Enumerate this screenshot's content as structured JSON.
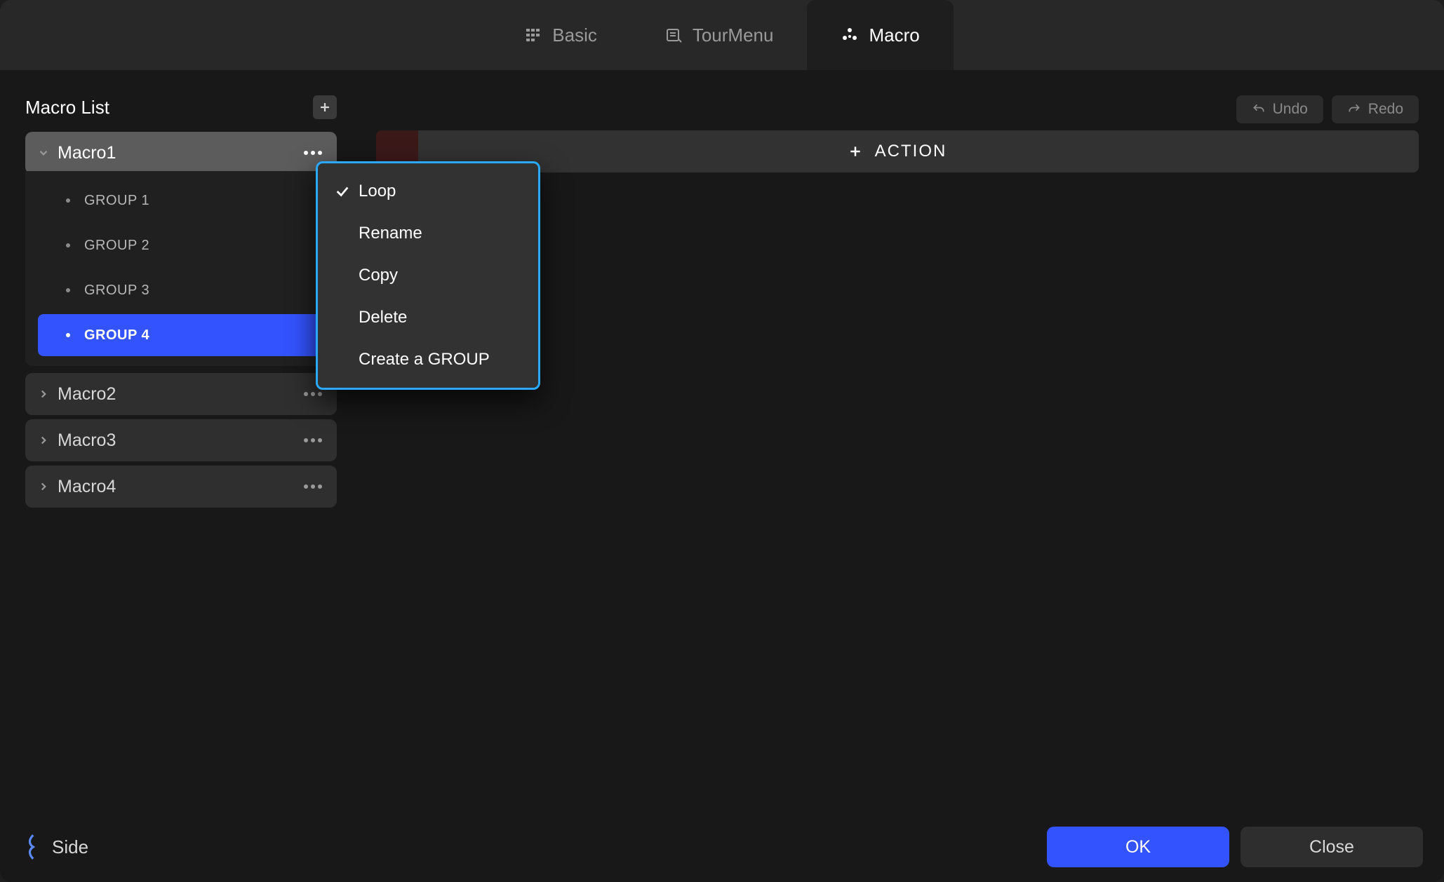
{
  "tabs": [
    {
      "label": "Basic",
      "active": false
    },
    {
      "label": "TourMenu",
      "active": false
    },
    {
      "label": "Macro",
      "active": true
    }
  ],
  "sidebar": {
    "title": "Macro List",
    "macros": [
      {
        "name": "Macro1",
        "expanded": true,
        "groups": [
          {
            "label": "GROUP 1",
            "selected": false
          },
          {
            "label": "GROUP 2",
            "selected": false
          },
          {
            "label": "GROUP 3",
            "selected": false
          },
          {
            "label": "GROUP 4",
            "selected": true
          }
        ]
      },
      {
        "name": "Macro2",
        "expanded": false,
        "groups": []
      },
      {
        "name": "Macro3",
        "expanded": false,
        "groups": []
      },
      {
        "name": "Macro4",
        "expanded": false,
        "groups": []
      }
    ]
  },
  "main": {
    "undo_label": "Undo",
    "redo_label": "Redo",
    "action_label": "ACTION"
  },
  "context_menu": {
    "items": [
      {
        "label": "Loop",
        "checked": true
      },
      {
        "label": "Rename",
        "checked": false
      },
      {
        "label": "Copy",
        "checked": false
      },
      {
        "label": "Delete",
        "checked": false
      },
      {
        "label": "Create a GROUP",
        "checked": false
      }
    ]
  },
  "footer": {
    "side_label": "Side",
    "ok_label": "OK",
    "close_label": "Close"
  }
}
